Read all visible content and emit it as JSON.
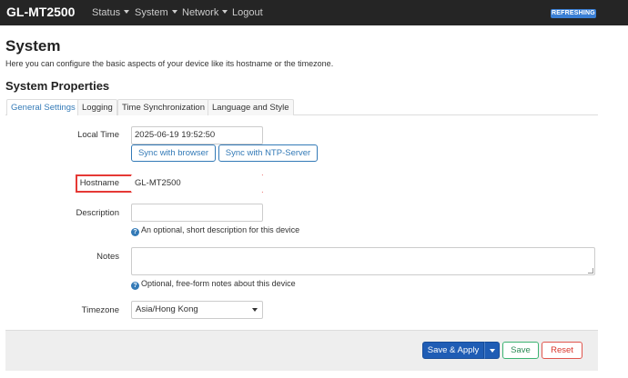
{
  "navbar": {
    "brand": "GL-MT2500",
    "menus": [
      {
        "label": "Status"
      },
      {
        "label": "System"
      },
      {
        "label": "Network"
      }
    ],
    "logout": "Logout",
    "badge": "REFRESHING"
  },
  "page": {
    "title": "System",
    "description": "Here you can configure the basic aspects of your device like its hostname or the timezone.",
    "section_title": "System Properties"
  },
  "tabs": [
    {
      "label": "General Settings",
      "active": true
    },
    {
      "label": "Logging",
      "active": false
    },
    {
      "label": "Time Synchronization",
      "active": false
    },
    {
      "label": "Language and Style",
      "active": false
    }
  ],
  "form": {
    "local_time": {
      "label": "Local Time",
      "value": "2025-06-19 19:52:50",
      "sync_browser": "Sync with browser",
      "sync_ntp": "Sync with NTP-Server"
    },
    "hostname": {
      "label": "Hostname",
      "value": "GL-MT2500"
    },
    "description": {
      "label": "Description",
      "value": "",
      "help": "An optional, short description for this device"
    },
    "notes": {
      "label": "Notes",
      "value": "",
      "help": "Optional, free-form notes about this device"
    },
    "timezone": {
      "label": "Timezone",
      "selected": "Asia/Hong Kong"
    }
  },
  "footer": {
    "save_apply": "Save & Apply",
    "save": "Save",
    "reset": "Reset"
  },
  "icons": {
    "help": "?"
  },
  "colors": {
    "navbar_bg": "#252525",
    "accent": "#337ab7",
    "primary_button": "#1f5db5",
    "save_green": "#3cb371",
    "reset_red": "#e0554d",
    "highlight": "#e53935"
  }
}
